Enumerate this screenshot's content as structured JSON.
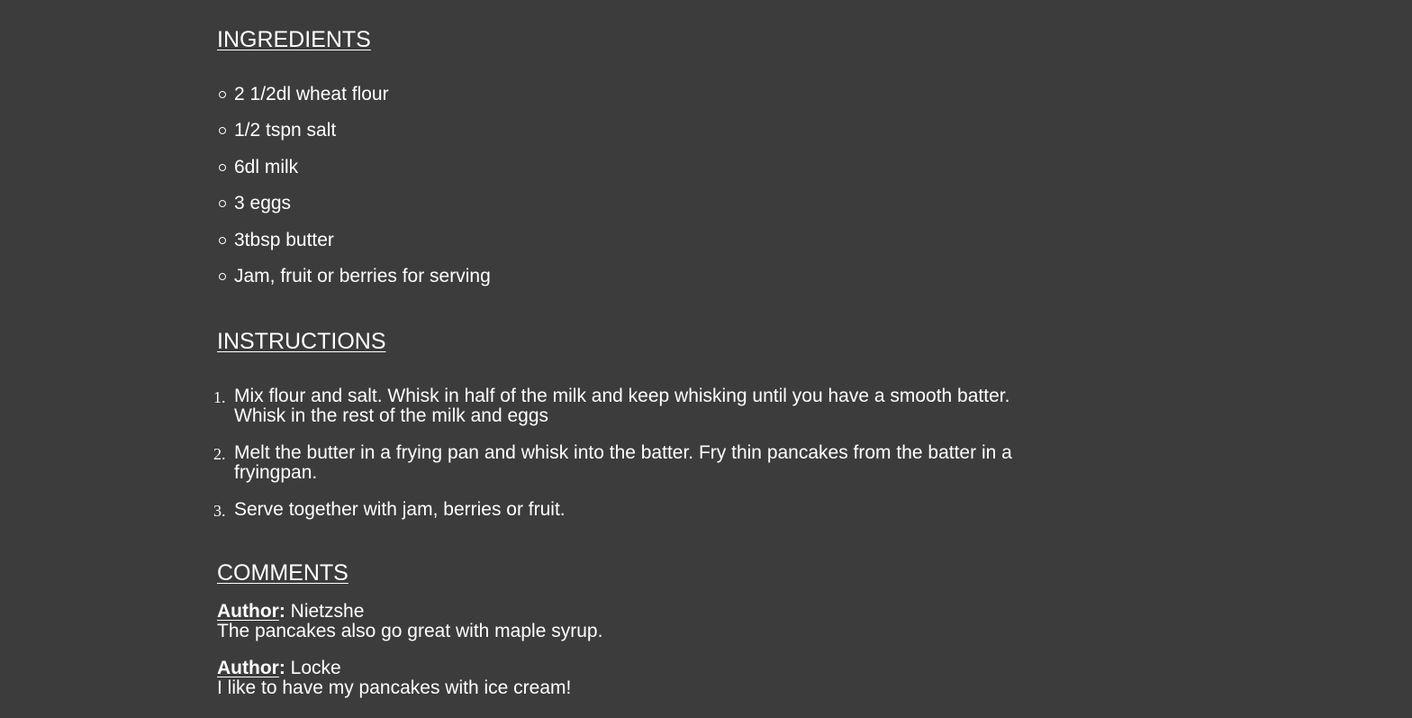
{
  "ingredients": {
    "heading": "INGREDIENTS",
    "items": [
      "2 1/2dl wheat flour",
      "1/2 tspn salt",
      "6dl milk",
      "3 eggs",
      "3tbsp butter",
      "Jam, fruit or berries for serving"
    ]
  },
  "instructions": {
    "heading": "INSTRUCTIONS",
    "steps": [
      {
        "number": "1.",
        "text": "Mix flour and salt. Whisk in half of the milk and keep whisking until you have a smooth batter. Whisk in the rest of the milk and eggs"
      },
      {
        "number": "2.",
        "text": "Melt the butter in a frying pan and whisk into the batter. Fry thin pancakes from the batter in a fryingpan."
      },
      {
        "number": "3.",
        "text": "Serve together with jam, berries or fruit."
      }
    ]
  },
  "comments": {
    "heading": "COMMENTS",
    "author_label": "Author",
    "items": [
      {
        "author": "Nietzshe",
        "text": "The pancakes also go great with maple syrup."
      },
      {
        "author": "Locke",
        "text": "I like to have my pancakes with ice cream!"
      }
    ]
  }
}
